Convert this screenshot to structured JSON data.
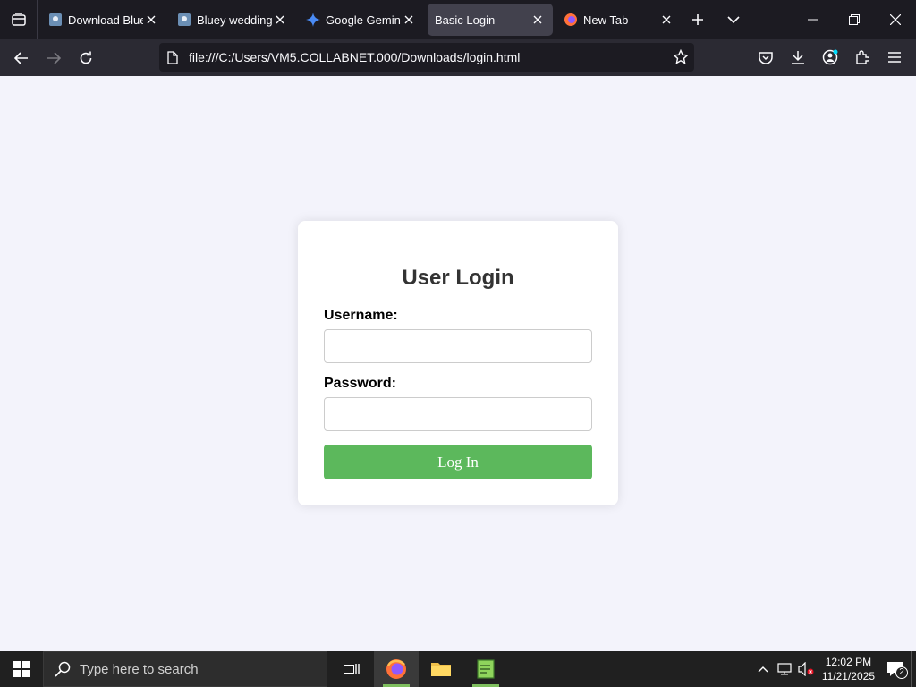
{
  "browser": {
    "tabs": [
      {
        "title": "Download Bluey",
        "icon": "image-page-icon"
      },
      {
        "title": "Bluey wedding V",
        "icon": "image-page-icon"
      },
      {
        "title": "Google Gemini",
        "icon": "gemini-icon"
      },
      {
        "title": "Basic Login",
        "icon": "none",
        "active": true
      },
      {
        "title": "New Tab",
        "icon": "firefox-icon"
      }
    ],
    "url": "file:///C:/Users/VM5.COLLABNET.000/Downloads/login.html",
    "accent_color": "#42414d"
  },
  "login": {
    "title": "User Login",
    "username_label": "Username:",
    "username_value": "",
    "password_label": "Password:",
    "password_value": "",
    "button_label": "Log In",
    "button_color": "#5cb85c"
  },
  "taskbar": {
    "search_placeholder": "Type here to search",
    "time": "12:02 PM",
    "date": "11/21/2025",
    "notification_count": "2"
  }
}
